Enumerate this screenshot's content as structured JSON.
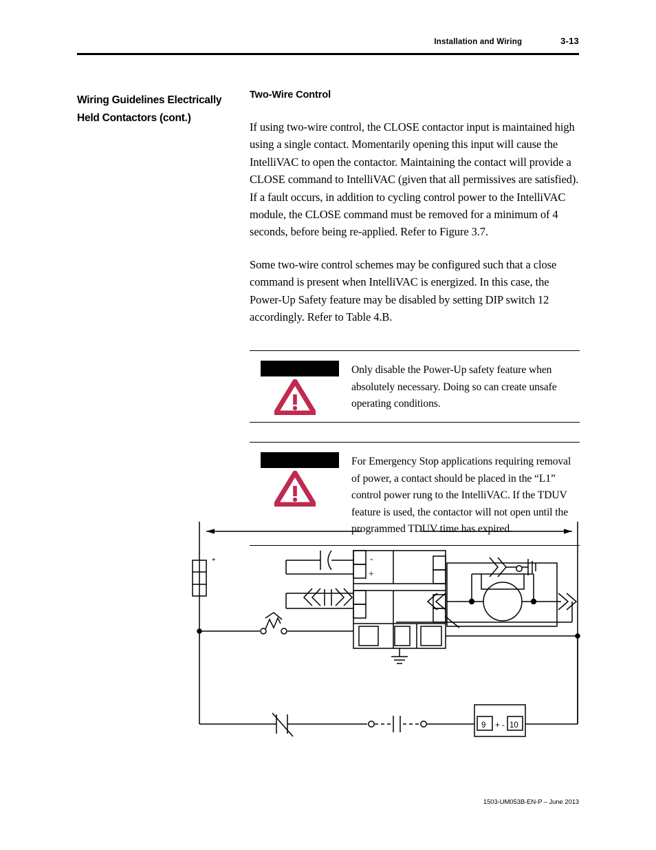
{
  "header": {
    "title": "Installation and Wiring",
    "page_number": "3-13"
  },
  "sidebar": {
    "heading_line1": "Wiring Guidelines Electrically",
    "heading_line2": "Held Contactors (cont.)"
  },
  "main": {
    "section_title": "Two-Wire Control",
    "paragraph_1": "If using two-wire control, the CLOSE contactor input is maintained high using a single contact. Momentarily opening this input will cause the IntelliVAC to open the contactor.  Maintaining the contact will provide a CLOSE command to IntelliVAC (given that all permissives are satisfied). If a fault occurs, in addition to cycling control power to the IntelliVAC module, the CLOSE command must be removed for a minimum of 4 seconds,  before being re-applied. Refer to Figure 3.7.",
    "paragraph_2": "Some two-wire control schemes may be configured such that a close command is present when IntelliVAC is energized. In this case, the Power-Up Safety feature may be disabled by setting DIP switch 12 accordingly.  Refer to Table 4.B."
  },
  "attention_boxes": [
    {
      "icon": "warning-triangle-icon",
      "label_redacted": true,
      "text": "Only disable the Power-Up safety feature when absolutely necessary.  Doing so can create unsafe operating conditions."
    },
    {
      "icon": "warning-triangle-icon",
      "label_redacted": true,
      "text": "For Emergency Stop applications requiring removal of power, a contact should be placed in the “L1” control power rung to the IntelliVAC. If the TDUV feature is used, the contactor will not open until the programmed TDUV time has expired."
    }
  ],
  "schematic": {
    "fuse_marker": "*",
    "module_polarity_minus": "-",
    "module_polarity_plus": "+",
    "terminal_left": "9",
    "terminal_plus": "+",
    "terminal_minus": "-",
    "terminal_right": "10"
  },
  "footer": {
    "publication": "1503-UM053B-EN-P  –  June 2013"
  },
  "colors": {
    "warning_red": "#C02A4E",
    "ink": "#000000",
    "paper": "#FFFFFF"
  }
}
